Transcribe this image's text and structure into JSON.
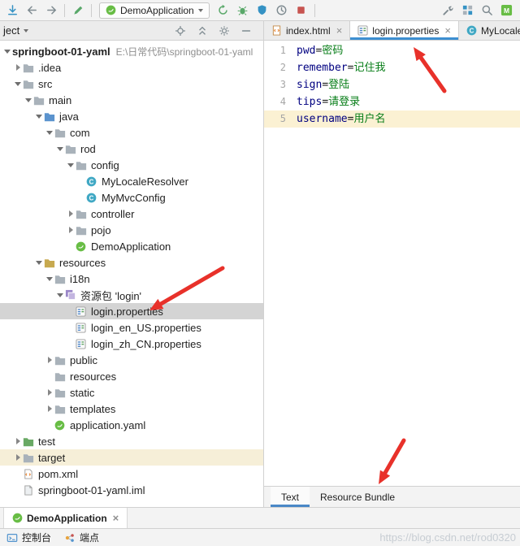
{
  "toolbar": {
    "run_config_label": "DemoApplication",
    "left_icons": [
      "vcs-update-icon",
      "back-icon",
      "forward-icon",
      "separator",
      "edit-icon",
      "separator"
    ],
    "run_icons": [
      "rerun-icon",
      "debug-icon",
      "coverage-icon",
      "profiler-icon",
      "stop-icon"
    ],
    "right_icons": [
      "settings-icon",
      "project-structure-icon",
      "search-icon",
      "maven-icon"
    ]
  },
  "project_panel": {
    "header_label": "ject",
    "header_icons": [
      "locate-icon",
      "collapse-all-icon",
      "gear-icon",
      "hide-icon"
    ],
    "tree": [
      {
        "label": "springboot-01-yaml",
        "suffix": "E:\\日常代码\\springboot-01-yaml",
        "level": 0,
        "chevron": "down",
        "icon": null,
        "bold": true
      },
      {
        "label": ".idea",
        "level": 1,
        "chevron": "right",
        "icon": "folder-icon"
      },
      {
        "label": "src",
        "level": 1,
        "chevron": "down",
        "icon": "folder-icon"
      },
      {
        "label": "main",
        "level": 2,
        "chevron": "down",
        "icon": "folder-icon"
      },
      {
        "label": "java",
        "level": 3,
        "chevron": "down",
        "icon": "folder-java-icon"
      },
      {
        "label": "com",
        "level": 4,
        "chevron": "down",
        "icon": "folder-icon"
      },
      {
        "label": "rod",
        "level": 5,
        "chevron": "down",
        "icon": "folder-icon"
      },
      {
        "label": "config",
        "level": 6,
        "chevron": "down",
        "icon": "folder-icon"
      },
      {
        "label": "MyLocaleResolver",
        "level": 7,
        "chevron": "none",
        "icon": "class-icon"
      },
      {
        "label": "MyMvcConfig",
        "level": 7,
        "chevron": "none",
        "icon": "class-icon"
      },
      {
        "label": "controller",
        "level": 6,
        "chevron": "right",
        "icon": "folder-icon"
      },
      {
        "label": "pojo",
        "level": 6,
        "chevron": "right",
        "icon": "folder-icon"
      },
      {
        "label": "DemoApplication",
        "level": 6,
        "chevron": "none",
        "icon": "spring-icon"
      },
      {
        "label": "resources",
        "level": 3,
        "chevron": "down",
        "icon": "folder-resources-icon"
      },
      {
        "label": "i18n",
        "level": 4,
        "chevron": "down",
        "icon": "folder-icon"
      },
      {
        "label": "资源包 'login'",
        "level": 5,
        "chevron": "down",
        "icon": "bundle-icon"
      },
      {
        "label": "login.properties",
        "level": 6,
        "chevron": "none",
        "icon": "properties-icon",
        "state": "selected"
      },
      {
        "label": "login_en_US.properties",
        "level": 6,
        "chevron": "none",
        "icon": "properties-icon"
      },
      {
        "label": "login_zh_CN.properties",
        "level": 6,
        "chevron": "none",
        "icon": "properties-icon"
      },
      {
        "label": "public",
        "level": 4,
        "chevron": "right",
        "icon": "folder-icon"
      },
      {
        "label": "resources",
        "level": 4,
        "chevron": "none",
        "icon": "folder-icon"
      },
      {
        "label": "static",
        "level": 4,
        "chevron": "right",
        "icon": "folder-icon"
      },
      {
        "label": "templates",
        "level": 4,
        "chevron": "right",
        "icon": "folder-icon"
      },
      {
        "label": "application.yaml",
        "level": 4,
        "chevron": "none",
        "icon": "yaml-icon"
      },
      {
        "label": "test",
        "level": 1,
        "chevron": "right",
        "icon": "folder-test-icon"
      },
      {
        "label": "target",
        "level": 1,
        "chevron": "right",
        "icon": "folder-icon",
        "state": "excluded"
      },
      {
        "label": "pom.xml",
        "level": 1,
        "chevron": "none",
        "icon": "pom-icon"
      },
      {
        "label": "springboot-01-yaml.iml",
        "level": 1,
        "chevron": "none",
        "icon": "iml-icon"
      }
    ]
  },
  "editor": {
    "tabs": [
      {
        "label": "index.html",
        "icon": "html-icon",
        "close": "×",
        "active": false
      },
      {
        "label": "login.properties",
        "icon": "properties-icon",
        "close": "×",
        "active": true
      },
      {
        "label": "MyLocale",
        "icon": "class-icon",
        "close": null,
        "active": false
      }
    ],
    "lines": [
      {
        "num": "1",
        "key": "pwd",
        "sep": "=",
        "value": "密码"
      },
      {
        "num": "2",
        "key": "remember",
        "sep": "=",
        "value": "记住我"
      },
      {
        "num": "3",
        "key": "sign",
        "sep": "=",
        "value": "登陆"
      },
      {
        "num": "4",
        "key": "tips",
        "sep": "=",
        "value": "请登录"
      },
      {
        "num": "5",
        "key": "username",
        "sep": "=",
        "value": "用户名",
        "caret_line": true
      }
    ],
    "bottom_tabs": [
      {
        "label": "Text",
        "active": true
      },
      {
        "label": "Resource Bundle",
        "active": false
      }
    ]
  },
  "run_panel": {
    "tab_label": "DemoApplication",
    "tab_icon": "spring-icon",
    "close": "×"
  },
  "status_bar": {
    "items": [
      {
        "label": "控制台",
        "icon": "console-icon"
      },
      {
        "label": "端点",
        "icon": "endpoints-icon"
      }
    ]
  },
  "watermark": "https://blog.csdn.net/rod0320",
  "colors": {
    "arrow_red": "#E8312A",
    "selection_gray": "#D4D4D4",
    "excluded_yellow": "#F6EFD8",
    "caret_line_yellow": "#FBF1D3",
    "property_key": "#000080",
    "property_value": "#067D17",
    "tab_underline_blue": "#3D8FD1"
  }
}
